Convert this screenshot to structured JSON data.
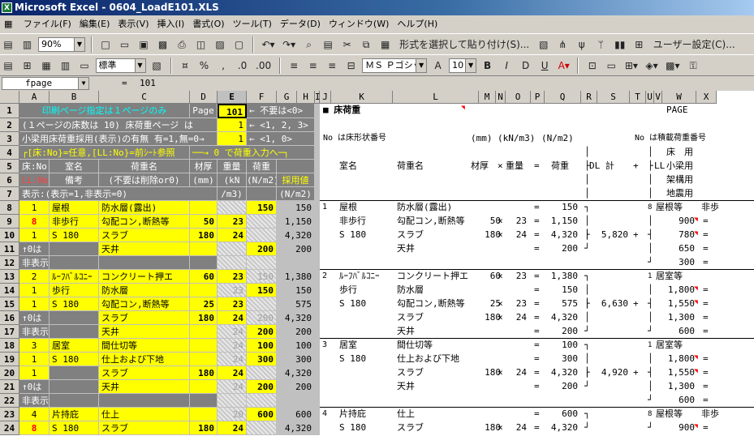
{
  "window": {
    "title": "Microsoft Excel - 0604_LoadE101.XLS",
    "icon": "excel-icon"
  },
  "menu": [
    "ファイル(F)",
    "編集(E)",
    "表示(V)",
    "挿入(I)",
    "書式(O)",
    "ツール(T)",
    "データ(D)",
    "ウィンドウ(W)",
    "ヘルプ(H)"
  ],
  "toolbar1": {
    "zoom": "90%",
    "paste_special": "形式を選択して貼り付け(S)...",
    "user_settings": "ユーザー設定(C)..."
  },
  "toolbar2": {
    "style": "標準",
    "font": "ＭＳ Ｐゴシッ",
    "size": "10"
  },
  "formula": {
    "name": "fpage",
    "eq": "=",
    "value": "101"
  },
  "columns": [
    {
      "name": "A",
      "w": 37
    },
    {
      "name": "B",
      "w": 61
    },
    {
      "name": "C",
      "w": 112
    },
    {
      "name": "D",
      "w": 34
    },
    {
      "name": "E",
      "w": 36
    },
    {
      "name": "F",
      "w": 37
    },
    {
      "name": "G",
      "w": 25
    },
    {
      "name": "H",
      "w": 22
    },
    {
      "name": "I",
      "w": 6
    },
    {
      "name": "J",
      "w": 14
    },
    {
      "name": "K",
      "w": 76
    },
    {
      "name": "L",
      "w": 106
    },
    {
      "name": "M",
      "w": 21
    },
    {
      "name": "N",
      "w": 12
    },
    {
      "name": "O",
      "w": 31
    },
    {
      "name": "P",
      "w": 17
    },
    {
      "name": "Q",
      "w": 45
    },
    {
      "name": "R",
      "w": 20
    },
    {
      "name": "S",
      "w": 40
    },
    {
      "name": "T",
      "w": 20
    },
    {
      "name": "U",
      "w": 10
    },
    {
      "name": "V",
      "w": 10
    },
    {
      "name": "W",
      "w": 42
    },
    {
      "name": "X",
      "w": 25
    }
  ],
  "selected_col": "E",
  "rows": [
    "1",
    "2",
    "3",
    "4",
    "5",
    "6",
    "7",
    "8",
    "9",
    "10",
    "11",
    "12",
    "13",
    "14",
    "15",
    "16",
    "17",
    "18",
    "19",
    "20",
    "21",
    "22",
    "23",
    "24"
  ],
  "left": {
    "r1_title": "印刷ページ指定は１ページのみ",
    "r1_page": "Page",
    "r1_val": "101",
    "r1_note": "← 不要は<0>",
    "r2_text": "(１ページの床数は 10) 床荷重ページ は",
    "r2_val": "1",
    "r2_note": "← <1, 2, 3>",
    "r3_text": "小梁用床荷重採用(表示)の有無 有=1,無=0→",
    "r3_val": "1",
    "r3_note": "← <1, 0>",
    "r4_text": "┌[床:No}=任意,[LL:No}=前ｼｰﾄ参照",
    "r4_note": "──→ 0 で荷重入力へ─┐",
    "h_no": "床:No",
    "h_ll": "LL:No",
    "h_room": "室名",
    "h_note": "備考",
    "h_load": "荷重名",
    "h_load2": "(不要は削除or0)",
    "h_thick": "材厚",
    "h_mm": "(mm)",
    "h_wt": "重量",
    "h_kn": "(kN",
    "h_m3": "/m3)",
    "h_load3": "荷重",
    "h_nm2": "(N/m2)",
    "h_adopt": "採用値",
    "h_adopt2": "(N/m2)",
    "r7_text": "表示:(表示=1,非表示=0)",
    "data": [
      {
        "a": "1",
        "b": "屋根",
        "c": "防水層(露出)",
        "d": "",
        "e": "",
        "f": "150",
        "g": "150"
      },
      {
        "a": "8",
        "b": "非歩行",
        "c": "勾配コン,断熱等",
        "d": "50",
        "e": "23",
        "f": "",
        "g": "1,150"
      },
      {
        "a": "1",
        "b": "S 180",
        "c": "スラブ",
        "d": "180",
        "e": "24",
        "f": "",
        "g": "4,320"
      },
      {
        "a": "↑0は",
        "b": "",
        "c": "天井",
        "d": "",
        "e": "",
        "f": "200",
        "g": "200"
      },
      {
        "a": "非表示",
        "b": "",
        "c": "",
        "d": "",
        "e": "",
        "f": "",
        "g": ""
      },
      {
        "a": "2",
        "b": "ﾙｰﾌﾊﾞﾙｺﾆｰ",
        "c": "コンクリート押エ",
        "d": "60",
        "e": "23",
        "f": "150",
        "g": "1,380"
      },
      {
        "a": "1",
        "b": "歩行",
        "c": "防水層",
        "d": "",
        "e": "23",
        "f": "150",
        "g": "150"
      },
      {
        "a": "1",
        "b": "S 180",
        "c": "勾配コン,断熱等",
        "d": "25",
        "e": "23",
        "f": "",
        "g": "575"
      },
      {
        "a": "↑0は",
        "b": "",
        "c": "スラブ",
        "d": "180",
        "e": "24",
        "f": "200",
        "g": "4,320"
      },
      {
        "a": "非表示",
        "b": "",
        "c": "天井",
        "d": "",
        "e": "24",
        "f": "200",
        "g": "200"
      },
      {
        "a": "3",
        "b": "居室",
        "c": "間仕切等",
        "d": "",
        "e": "24",
        "f": "100",
        "g": "100"
      },
      {
        "a": "1",
        "b": "S 180",
        "c": "仕上および下地",
        "d": "",
        "e": "24",
        "f": "300",
        "g": "300"
      },
      {
        "a": "1",
        "b": "",
        "c": "スラブ",
        "d": "180",
        "e": "24",
        "f": "",
        "g": "4,320"
      },
      {
        "a": "↑0は",
        "b": "",
        "c": "天井",
        "d": "",
        "e": "24",
        "f": "200",
        "g": "200"
      },
      {
        "a": "非表示",
        "b": "",
        "c": "",
        "d": "",
        "e": "",
        "f": "",
        "g": ""
      },
      {
        "a": "4",
        "b": "片持庇",
        "c": "仕上",
        "d": "",
        "e": "20",
        "f": "600",
        "g": "600"
      },
      {
        "a": "8",
        "b": "S 180",
        "c": "スラブ",
        "d": "180",
        "e": "24",
        "f": "",
        "g": "4,320"
      }
    ]
  },
  "right": {
    "title": "■ 床荷重",
    "page": "PAGE",
    "hdr1": "No は床形状番号",
    "hdr_mm": "(mm)",
    "hdr_kn": "(kN/m3)",
    "hdr_nm2": "(N/m2)",
    "hdr_no2": "No は積載荷重番号",
    "hdr_room": "室名",
    "hdr_load": "荷重名",
    "hdr_thick": "材厚",
    "hdr_x": "×",
    "hdr_wt": "重量",
    "hdr_eq": "=",
    "hdr_ld": "荷重",
    "hdr_dl": "DL 計",
    "hdr_plus": "+",
    "hdr_ll": "LL",
    "hdr_floor": "床　用",
    "hdr_beam": "小梁用",
    "hdr_frame": "架構用",
    "hdr_quake": "地震用",
    "groups": [
      {
        "no": "1",
        "rows": [
          [
            "屋根",
            "防水層(露出)",
            "",
            "",
            "150"
          ],
          [
            "非歩行",
            "勾配コン,断熱等",
            "50",
            "23",
            "1,150"
          ],
          [
            "S 180",
            "スラブ",
            "180",
            "24",
            "4,320"
          ],
          [
            "",
            "天井",
            "",
            "",
            "200"
          ]
        ],
        "dl": "5,820",
        "ll_no": "8",
        "ll_name": "屋根等",
        "ll_extra": "非歩",
        "ll_vals": [
          "900",
          "780",
          "650",
          "300"
        ]
      },
      {
        "no": "2",
        "rows": [
          [
            "ﾙｰﾌﾊﾞﾙｺﾆｰ",
            "コンクリート押エ",
            "60",
            "23",
            "1,380"
          ],
          [
            "歩行",
            "防水層",
            "",
            "",
            "150"
          ],
          [
            "S 180",
            "勾配コン,断熱等",
            "25",
            "23",
            "575"
          ],
          [
            "",
            "スラブ",
            "180",
            "24",
            "4,320"
          ],
          [
            "",
            "天井",
            "",
            "",
            "200"
          ]
        ],
        "dl": "6,630",
        "ll_no": "1",
        "ll_name": "居室等",
        "ll_extra": "",
        "ll_vals": [
          "1,800",
          "1,550",
          "1,300",
          "600"
        ]
      },
      {
        "no": "3",
        "rows": [
          [
            "居室",
            "間仕切等",
            "",
            "",
            "100"
          ],
          [
            "S 180",
            "仕上および下地",
            "",
            "",
            "300"
          ],
          [
            "",
            "スラブ",
            "180",
            "24",
            "4,320"
          ],
          [
            "",
            "天井",
            "",
            "",
            "200"
          ]
        ],
        "dl": "4,920",
        "ll_no": "1",
        "ll_name": "居室等",
        "ll_extra": "",
        "ll_vals": [
          "1,800",
          "1,550",
          "1,300",
          "600"
        ]
      },
      {
        "no": "4",
        "rows": [
          [
            "片持庇",
            "仕上",
            "",
            "",
            "600"
          ],
          [
            "S 180",
            "スラブ",
            "180",
            "24",
            "4,320"
          ]
        ],
        "dl": "",
        "ll_no": "8",
        "ll_name": "屋根等",
        "ll_extra": "非歩",
        "ll_vals": [
          "900"
        ]
      }
    ]
  }
}
